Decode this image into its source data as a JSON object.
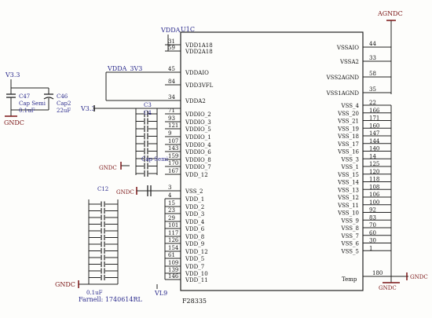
{
  "part": {
    "ref": "U1C",
    "value": "F28335",
    "footer": "Farnell: 1740614RL"
  },
  "left_pins": [
    {
      "name": "VDD1A18",
      "num": "31"
    },
    {
      "name": "VDD2A18",
      "num": "59"
    },
    {
      "name": "VDDAIO",
      "num": "45"
    },
    {
      "name": "VDD3VFL",
      "num": "84"
    },
    {
      "name": "VDDA2",
      "num": "34"
    },
    {
      "name": "VDDIO_2",
      "num": "71"
    },
    {
      "name": "VDDIO_3",
      "num": "93"
    },
    {
      "name": "VDDIO_5",
      "num": "121"
    },
    {
      "name": "VDDIO_1",
      "num": "9"
    },
    {
      "name": "VDDIO_4",
      "num": "107"
    },
    {
      "name": "VDDIO_6",
      "num": "143"
    },
    {
      "name": "VDDIO_8",
      "num": "159"
    },
    {
      "name": "VDDIO_7",
      "num": "170"
    },
    {
      "name": "VDD_12",
      "num": "167"
    },
    {
      "name": "VSS_2",
      "num": "3"
    },
    {
      "name": "VDD_1",
      "num": "4"
    },
    {
      "name": "VDD_2",
      "num": "15"
    },
    {
      "name": "VDD_3",
      "num": "23"
    },
    {
      "name": "VDD_4",
      "num": "29"
    },
    {
      "name": "VDD_6",
      "num": "101"
    },
    {
      "name": "VDD_8",
      "num": "117"
    },
    {
      "name": "VDD_9",
      "num": "126"
    },
    {
      "name": "VDD_12",
      "num": "154"
    },
    {
      "name": "VDD_5",
      "num": "61"
    },
    {
      "name": "VDD_7",
      "num": "109"
    },
    {
      "name": "VDD_10",
      "num": "139"
    },
    {
      "name": "VDD_11",
      "num": "146"
    }
  ],
  "right_pins_top": [
    {
      "name": "VSSAIO",
      "num": "44"
    },
    {
      "name": "VSSA2",
      "num": "33"
    },
    {
      "name": "VSS2AGND",
      "num": "58"
    },
    {
      "name": "VSS1AGND",
      "num": "35"
    }
  ],
  "right_pins": [
    {
      "name": "VSS_4",
      "num": "22"
    },
    {
      "name": "VSS_20",
      "num": "166"
    },
    {
      "name": "VSS_21",
      "num": "171"
    },
    {
      "name": "VSS_19",
      "num": "160"
    },
    {
      "name": "VSS_18",
      "num": "147"
    },
    {
      "name": "VSS_17",
      "num": "144"
    },
    {
      "name": "VSS_16",
      "num": "140"
    },
    {
      "name": "VSS_3",
      "num": "14"
    },
    {
      "name": "VSS_1",
      "num": "125"
    },
    {
      "name": "VSS_15",
      "num": "120"
    },
    {
      "name": "VSS_14",
      "num": "118"
    },
    {
      "name": "VSS_13",
      "num": "108"
    },
    {
      "name": "VSS_12",
      "num": "106"
    },
    {
      "name": "VSS_11",
      "num": "100"
    },
    {
      "name": "VSS_10",
      "num": "92"
    },
    {
      "name": "VSS_9",
      "num": "83"
    },
    {
      "name": "VSS_8",
      "num": "70"
    },
    {
      "name": "VSS_7",
      "num": "60"
    },
    {
      "name": "VSS_6",
      "num": "30"
    },
    {
      "name": "VSS_5",
      "num": "1"
    }
  ],
  "right_bottom_pin": {
    "name": "Temp",
    "num": "180"
  },
  "nets": {
    "agndc_top": "AGNDC",
    "vdda": "VDDA",
    "vdda_3v3": "VDDA_3V3",
    "v33_a": "V3.3",
    "v33_b": "V3.3",
    "gndc_left": "GNDC",
    "gndc_mid": "GNDC",
    "gndc_mid2": "GNDC",
    "gndc_bottom": "GNDC",
    "gndc_right": "GNDC",
    "vl9": "VL9"
  },
  "caps": {
    "c47_ref": "C47",
    "c47_val": "Cap Semi",
    "c47_val2": "0.1uF",
    "c46_ref": "C46",
    "c46_val": "Cap2",
    "c46_val2": "22uF",
    "c3_ref": "C3",
    "c12_ref": "C12",
    "c4_ref": "C4",
    "c4_val": "0.1uF",
    "cap_semi": "Cap Semi",
    "bottom_val": "0.1uF"
  }
}
